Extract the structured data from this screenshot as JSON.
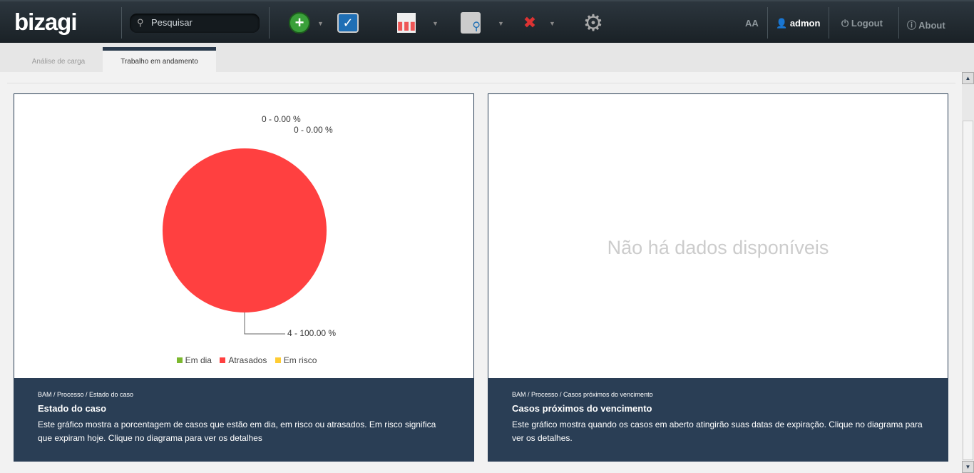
{
  "header": {
    "logo": "bizagi",
    "search_placeholder": "Pesquisar",
    "font_size_label": "AA",
    "user": "admon",
    "logout": "Logout",
    "about": "About"
  },
  "tabs": [
    {
      "label": "Análise de carga",
      "active": false
    },
    {
      "label": "Trabalho em andamento",
      "active": true
    }
  ],
  "left_panel": {
    "chart_data": {
      "type": "pie",
      "series": [
        {
          "name": "Em dia",
          "value": 0,
          "label": "0 - 0.00 %",
          "color": "#7cb82f"
        },
        {
          "name": "Atrasados",
          "value": 4,
          "label": "4 - 100.00 %",
          "color": "#ff4040"
        },
        {
          "name": "Em risco",
          "value": 0,
          "label": "0 - 0.00 %",
          "color": "#ffcc33"
        }
      ],
      "legend": "bottom"
    },
    "breadcrumb": "BAM / Processo / Estado do caso",
    "title": "Estado do caso",
    "description": "Este gráfico mostra a porcentagem de casos que estão em dia, em risco ou atrasados. Em risco significa que expiram hoje. Clique no diagrama para ver os detalhes"
  },
  "right_panel": {
    "no_data": "Não há dados disponíveis",
    "breadcrumb": "BAM / Processo / Casos próximos do vencimento",
    "title": "Casos próximos do vencimento",
    "description": "Este gráfico mostra quando os casos em aberto atingirão suas datas de expiração. Clique no diagrama para ver os detalhes."
  }
}
